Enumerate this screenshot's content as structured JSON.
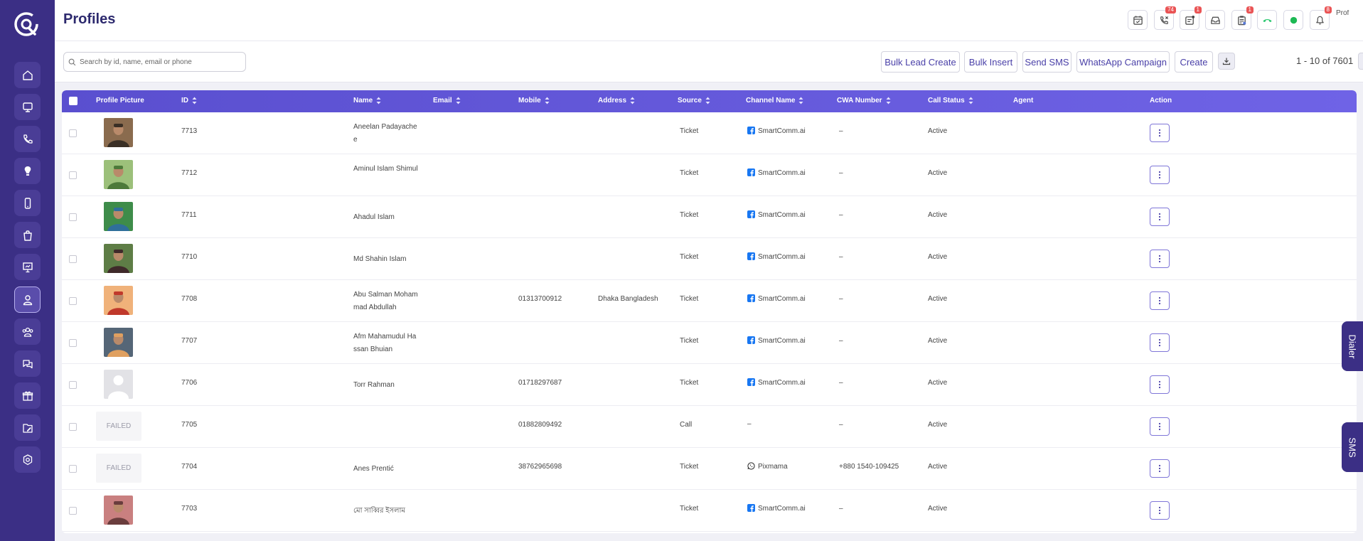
{
  "page": {
    "title": "Profiles"
  },
  "header": {
    "badges": {
      "missed_calls": "74",
      "tasks": "1",
      "clipboard": "1",
      "notifications": "8"
    },
    "avatar_alt": "Prof"
  },
  "toolbar": {
    "search_placeholder": "Search by id, name, email or phone",
    "buttons": {
      "bulk_lead_create": "Bulk Lead Create",
      "bulk_insert": "Bulk Insert",
      "send_sms": "Send SMS",
      "whatsapp_campaign": "WhatsApp Campaign",
      "create": "Create"
    },
    "pagination": "1 - 10 of 7601"
  },
  "table": {
    "columns": {
      "profile_picture": "Profile Picture",
      "id": "ID",
      "name": "Name",
      "email": "Email",
      "mobile": "Mobile",
      "address": "Address",
      "source": "Source",
      "channel_name": "Channel Name",
      "cwa_number": "CWA Number",
      "call_status": "Call Status",
      "agent": "Agent",
      "action": "Action"
    },
    "rows": [
      {
        "pic": "photo",
        "id": "7713",
        "name": "Aneelan Padayache e",
        "email": "",
        "mobile": "",
        "address": "",
        "source": "Ticket",
        "channel_icon": "facebook-icon",
        "channel": "SmartComm.ai",
        "cwa": "–",
        "status": "Active",
        "agent": ""
      },
      {
        "pic": "photo",
        "id": "7712",
        "name": "Aminul Islam Shimul",
        "email": "",
        "mobile": "",
        "address": "",
        "source": "Ticket",
        "channel_icon": "facebook-icon",
        "channel": "SmartComm.ai",
        "cwa": "–",
        "status": "Active",
        "agent": ""
      },
      {
        "pic": "photo",
        "id": "7711",
        "name": "Ahadul Islam",
        "email": "",
        "mobile": "",
        "address": "",
        "source": "Ticket",
        "channel_icon": "facebook-icon",
        "channel": "SmartComm.ai",
        "cwa": "–",
        "status": "Active",
        "agent": ""
      },
      {
        "pic": "photo",
        "id": "7710",
        "name": "Md Shahin Islam",
        "email": "",
        "mobile": "",
        "address": "",
        "source": "Ticket",
        "channel_icon": "facebook-icon",
        "channel": "SmartComm.ai",
        "cwa": "–",
        "status": "Active",
        "agent": ""
      },
      {
        "pic": "photo",
        "id": "7708",
        "name": "Abu Salman Moham mad Abdullah",
        "email": "",
        "mobile": "01313700912",
        "address": "Dhaka Bangladesh",
        "source": "Ticket",
        "channel_icon": "facebook-icon",
        "channel": "SmartComm.ai",
        "cwa": "–",
        "status": "Active",
        "agent": ""
      },
      {
        "pic": "photo",
        "id": "7707",
        "name": "Afm Mahamudul Ha ssan Bhuian",
        "email": "",
        "mobile": "",
        "address": "",
        "source": "Ticket",
        "channel_icon": "facebook-icon",
        "channel": "SmartComm.ai",
        "cwa": "–",
        "status": "Active",
        "agent": ""
      },
      {
        "pic": "placeholder",
        "id": "7706",
        "name": "Torr Rahman",
        "email": "",
        "mobile": "01718297687",
        "address": "",
        "source": "Ticket",
        "channel_icon": "facebook-icon",
        "channel": "SmartComm.ai",
        "cwa": "–",
        "status": "Active",
        "agent": ""
      },
      {
        "pic": "failed",
        "failed_text": "FAILED",
        "id": "7705",
        "name": "",
        "email": "",
        "mobile": "01882809492",
        "address": "",
        "source": "Call",
        "channel_icon": "",
        "channel": "–",
        "cwa": "–",
        "status": "Active",
        "agent": ""
      },
      {
        "pic": "failed",
        "failed_text": "FAILED",
        "id": "7704",
        "name": "Anes Prentić",
        "email": "",
        "mobile": "38762965698",
        "address": "",
        "source": "Ticket",
        "channel_icon": "whatsapp-icon",
        "channel": "Pixmama",
        "cwa": "+880 1540-109425",
        "status": "Active",
        "agent": ""
      },
      {
        "pic": "photo",
        "id": "7703",
        "name": "মো সাব্বির ইসলাম",
        "email": "",
        "mobile": "",
        "address": "",
        "source": "Ticket",
        "channel_icon": "facebook-icon",
        "channel": "SmartComm.ai",
        "cwa": "–",
        "status": "Active",
        "agent": ""
      }
    ]
  },
  "side_tabs": {
    "dialer": "Dialer",
    "sms": "SMS"
  },
  "colors": {
    "sidebar": "#3b2f85",
    "accent": "#5a4fcf",
    "facebook": "#1877f2",
    "whatsapp": "#25d366",
    "badge": "#ea5455"
  }
}
